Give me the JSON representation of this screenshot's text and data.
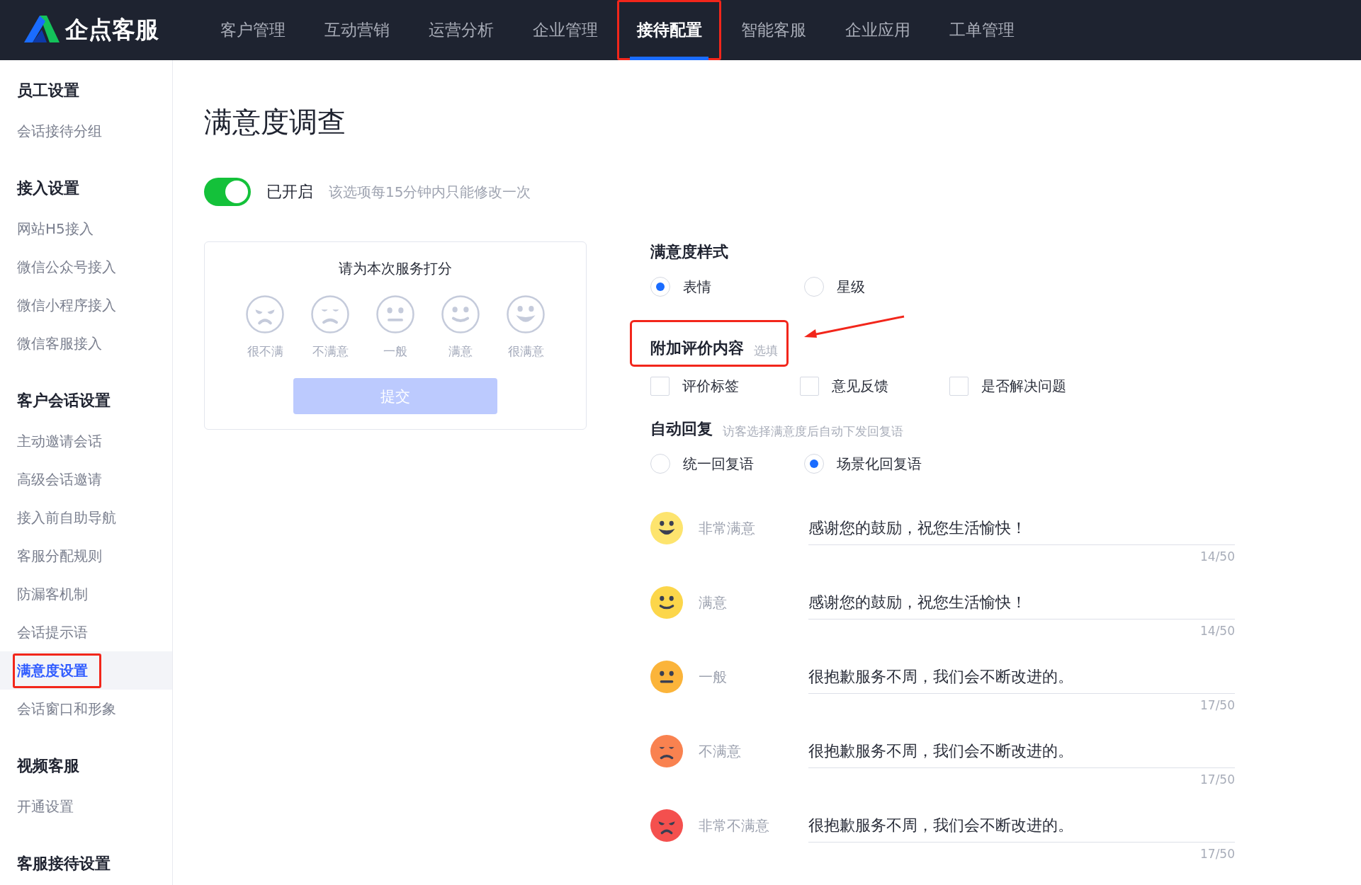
{
  "brand": {
    "name": "企点客服"
  },
  "nav": [
    {
      "label": "客户管理",
      "selected": false,
      "highlighted": false
    },
    {
      "label": "互动营销",
      "selected": false,
      "highlighted": false
    },
    {
      "label": "运营分析",
      "selected": false,
      "highlighted": false
    },
    {
      "label": "企业管理",
      "selected": false,
      "highlighted": false
    },
    {
      "label": "接待配置",
      "selected": true,
      "highlighted": true
    },
    {
      "label": "智能客服",
      "selected": false,
      "highlighted": false
    },
    {
      "label": "企业应用",
      "selected": false,
      "highlighted": false
    },
    {
      "label": "工单管理",
      "selected": false,
      "highlighted": false
    }
  ],
  "sidebar": {
    "groups": [
      {
        "title": "员工设置",
        "items": [
          {
            "label": "会话接待分组",
            "selected": false,
            "highlighted": false
          }
        ]
      },
      {
        "title": "接入设置",
        "items": [
          {
            "label": "网站H5接入",
            "selected": false,
            "highlighted": false
          },
          {
            "label": "微信公众号接入",
            "selected": false,
            "highlighted": false
          },
          {
            "label": "微信小程序接入",
            "selected": false,
            "highlighted": false
          },
          {
            "label": "微信客服接入",
            "selected": false,
            "highlighted": false
          }
        ]
      },
      {
        "title": "客户会话设置",
        "items": [
          {
            "label": "主动邀请会话",
            "selected": false,
            "highlighted": false
          },
          {
            "label": "高级会话邀请",
            "selected": false,
            "highlighted": false
          },
          {
            "label": "接入前自助导航",
            "selected": false,
            "highlighted": false
          },
          {
            "label": "客服分配规则",
            "selected": false,
            "highlighted": false
          },
          {
            "label": "防漏客机制",
            "selected": false,
            "highlighted": false
          },
          {
            "label": "会话提示语",
            "selected": false,
            "highlighted": false
          },
          {
            "label": "满意度设置",
            "selected": true,
            "highlighted": true
          },
          {
            "label": "会话窗口和形象",
            "selected": false,
            "highlighted": false
          }
        ]
      },
      {
        "title": "视频客服",
        "items": [
          {
            "label": "开通设置",
            "selected": false,
            "highlighted": false
          }
        ]
      },
      {
        "title": "客服接待设置"
      }
    ]
  },
  "page": {
    "title": "满意度调查"
  },
  "toggle": {
    "on": true,
    "label": "已开启",
    "hint": "该选项每15分钟内只能修改一次"
  },
  "preview": {
    "prompt": "请为本次服务打分",
    "faces": [
      {
        "kind": "very_unsatisfied",
        "label": "很不满"
      },
      {
        "kind": "unsatisfied",
        "label": "不满意"
      },
      {
        "kind": "neutral",
        "label": "一般"
      },
      {
        "kind": "satisfied",
        "label": "满意"
      },
      {
        "kind": "very_satisfied",
        "label": "很满意"
      }
    ],
    "submit": {
      "label": "提交",
      "disabled": true
    }
  },
  "style_section": {
    "title": "满意度样式",
    "options": [
      {
        "label": "表情",
        "selected": true
      },
      {
        "label": "星级",
        "selected": false
      }
    ]
  },
  "extra_section": {
    "title": "附加评价内容",
    "note": "选填",
    "highlighted": true,
    "options": [
      {
        "label": "评价标签",
        "checked": false
      },
      {
        "label": "意见反馈",
        "checked": false
      },
      {
        "label": "是否解决问题",
        "checked": false
      }
    ]
  },
  "reply_section": {
    "title": "自动回复",
    "note": "访客选择满意度后自动下发回复语",
    "options": [
      {
        "label": "统一回复语",
        "selected": false
      },
      {
        "label": "场景化回复语",
        "selected": true
      }
    ],
    "replies": [
      {
        "kind": "very_satisfied",
        "color": "#fde46e",
        "label": "非常满意",
        "value": "感谢您的鼓励，祝您生活愉快！",
        "count": "14/50"
      },
      {
        "kind": "satisfied",
        "color": "#fcd64a",
        "label": "满意",
        "value": "感谢您的鼓励，祝您生活愉快！",
        "count": "14/50"
      },
      {
        "kind": "neutral",
        "color": "#fbb43a",
        "label": "一般",
        "value": "很抱歉服务不周，我们会不断改进的。",
        "count": "17/50"
      },
      {
        "kind": "unsatisfied",
        "color": "#f98250",
        "label": "不满意",
        "value": "很抱歉服务不周，我们会不断改进的。",
        "count": "17/50"
      },
      {
        "kind": "very_unsatisfied",
        "color": "#f4504e",
        "label": "非常不满意",
        "value": "很抱歉服务不周，我们会不断改进的。",
        "count": "17/50"
      }
    ]
  }
}
